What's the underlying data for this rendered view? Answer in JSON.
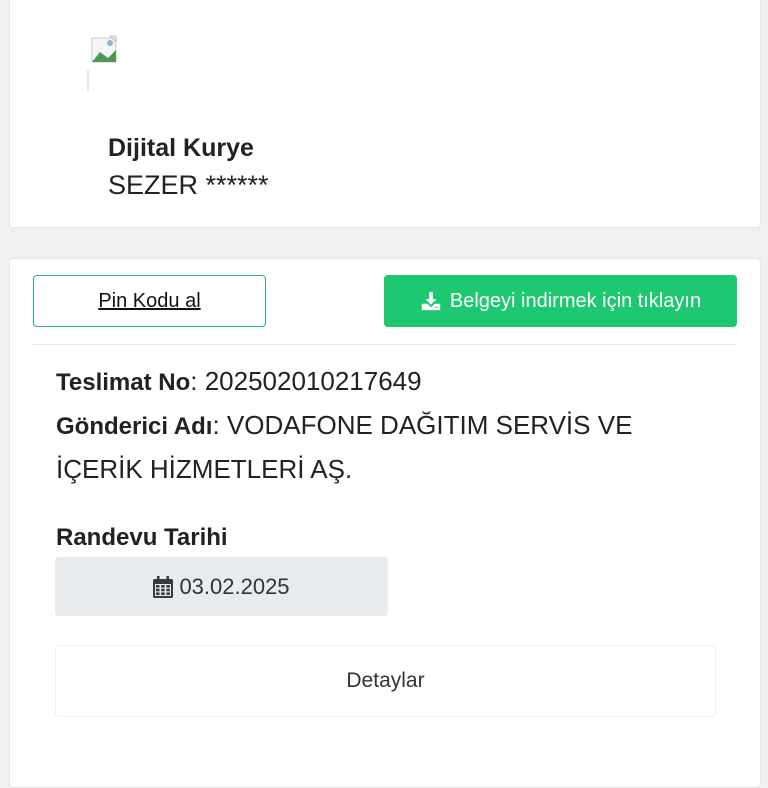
{
  "courier": {
    "title": "Dijital Kurye",
    "name": "SEZER ******"
  },
  "actions": {
    "pin_label": "Pin Kodu al",
    "download_label": "Belgeyi indirmek için tıklayın"
  },
  "delivery": {
    "teslimat_label": "Teslimat No",
    "teslimat_value": ": 202502010217649",
    "gonderici_label": "Gönderici Adı",
    "gonderici_value_line1": ": VODAFONE DAĞITIM SERVİS VE",
    "gonderici_value_line2": "İÇERİK HİZMETLERİ AŞ."
  },
  "appointment": {
    "label": "Randevu Tarihi",
    "date": "03.02.2025"
  },
  "details_label": "Detaylar",
  "colors": {
    "accent": "#1ec870",
    "outline": "#22b573"
  }
}
